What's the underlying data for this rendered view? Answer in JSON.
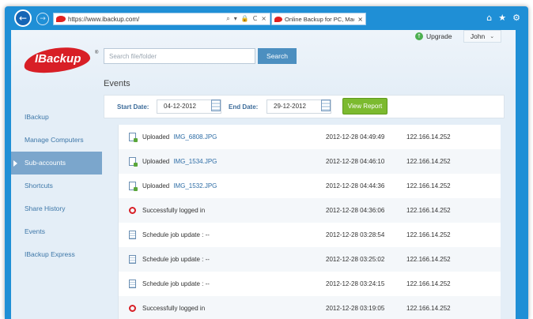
{
  "browser": {
    "url": "https://www.ibackup.com/",
    "tab_title": "Online Backup for PC, Mac ...",
    "tab_close": "×",
    "back": "←",
    "forward": "→",
    "addr_icons": [
      "⌕",
      "▾",
      "🔒",
      "C",
      "×"
    ],
    "win_icons": [
      "⌂",
      "★",
      "⚙"
    ]
  },
  "header": {
    "logo_text": "IBackup",
    "logo_reg": "®",
    "search_placeholder": "Search file/folder",
    "search_label": "Search",
    "upgrade_label": "Upgrade",
    "upgrade_icon": "↑",
    "user_name": "John",
    "user_chevron": "⌄",
    "page_title": "Events"
  },
  "sidebar": {
    "items": [
      {
        "label": "IBackup",
        "active": false
      },
      {
        "label": "Manage Computers",
        "active": false
      },
      {
        "label": "Sub-accounts",
        "active": true
      },
      {
        "label": "Shortcuts",
        "active": false
      },
      {
        "label": "Share History",
        "active": false
      },
      {
        "label": "Events",
        "active": false
      },
      {
        "label": "IBackup Express",
        "active": false
      }
    ]
  },
  "filter": {
    "start_label": "Start Date:",
    "start_value": "04-12-2012",
    "end_label": "End Date:",
    "end_value": "29-12-2012",
    "view_report_label": "View Report"
  },
  "events": [
    {
      "icon": "upload",
      "action": "Uploaded",
      "file": "IMG_6808.JPG",
      "time": "2012-12-28 04:49:49",
      "ip": "122.166.14.252"
    },
    {
      "icon": "upload",
      "action": "Uploaded",
      "file": "IMG_1534.JPG",
      "time": "2012-12-28 04:46:10",
      "ip": "122.166.14.252"
    },
    {
      "icon": "upload",
      "action": "Uploaded",
      "file": "IMG_1532.JPG",
      "time": "2012-12-28 04:44:36",
      "ip": "122.166.14.252"
    },
    {
      "icon": "login",
      "action": "Successfully logged in",
      "file": "",
      "time": "2012-12-28 04:36:06",
      "ip": "122.166.14.252"
    },
    {
      "icon": "schedule",
      "action": "Schedule job update : --",
      "file": "",
      "time": "2012-12-28 03:28:54",
      "ip": "122.166.14.252"
    },
    {
      "icon": "schedule",
      "action": "Schedule job update : --",
      "file": "",
      "time": "2012-12-28 03:25:02",
      "ip": "122.166.14.252"
    },
    {
      "icon": "schedule",
      "action": "Schedule job update : --",
      "file": "",
      "time": "2012-12-28 03:24:15",
      "ip": "122.166.14.252"
    },
    {
      "icon": "login",
      "action": "Successfully logged in",
      "file": "",
      "time": "2012-12-28 03:19:05",
      "ip": "122.166.14.252"
    }
  ]
}
